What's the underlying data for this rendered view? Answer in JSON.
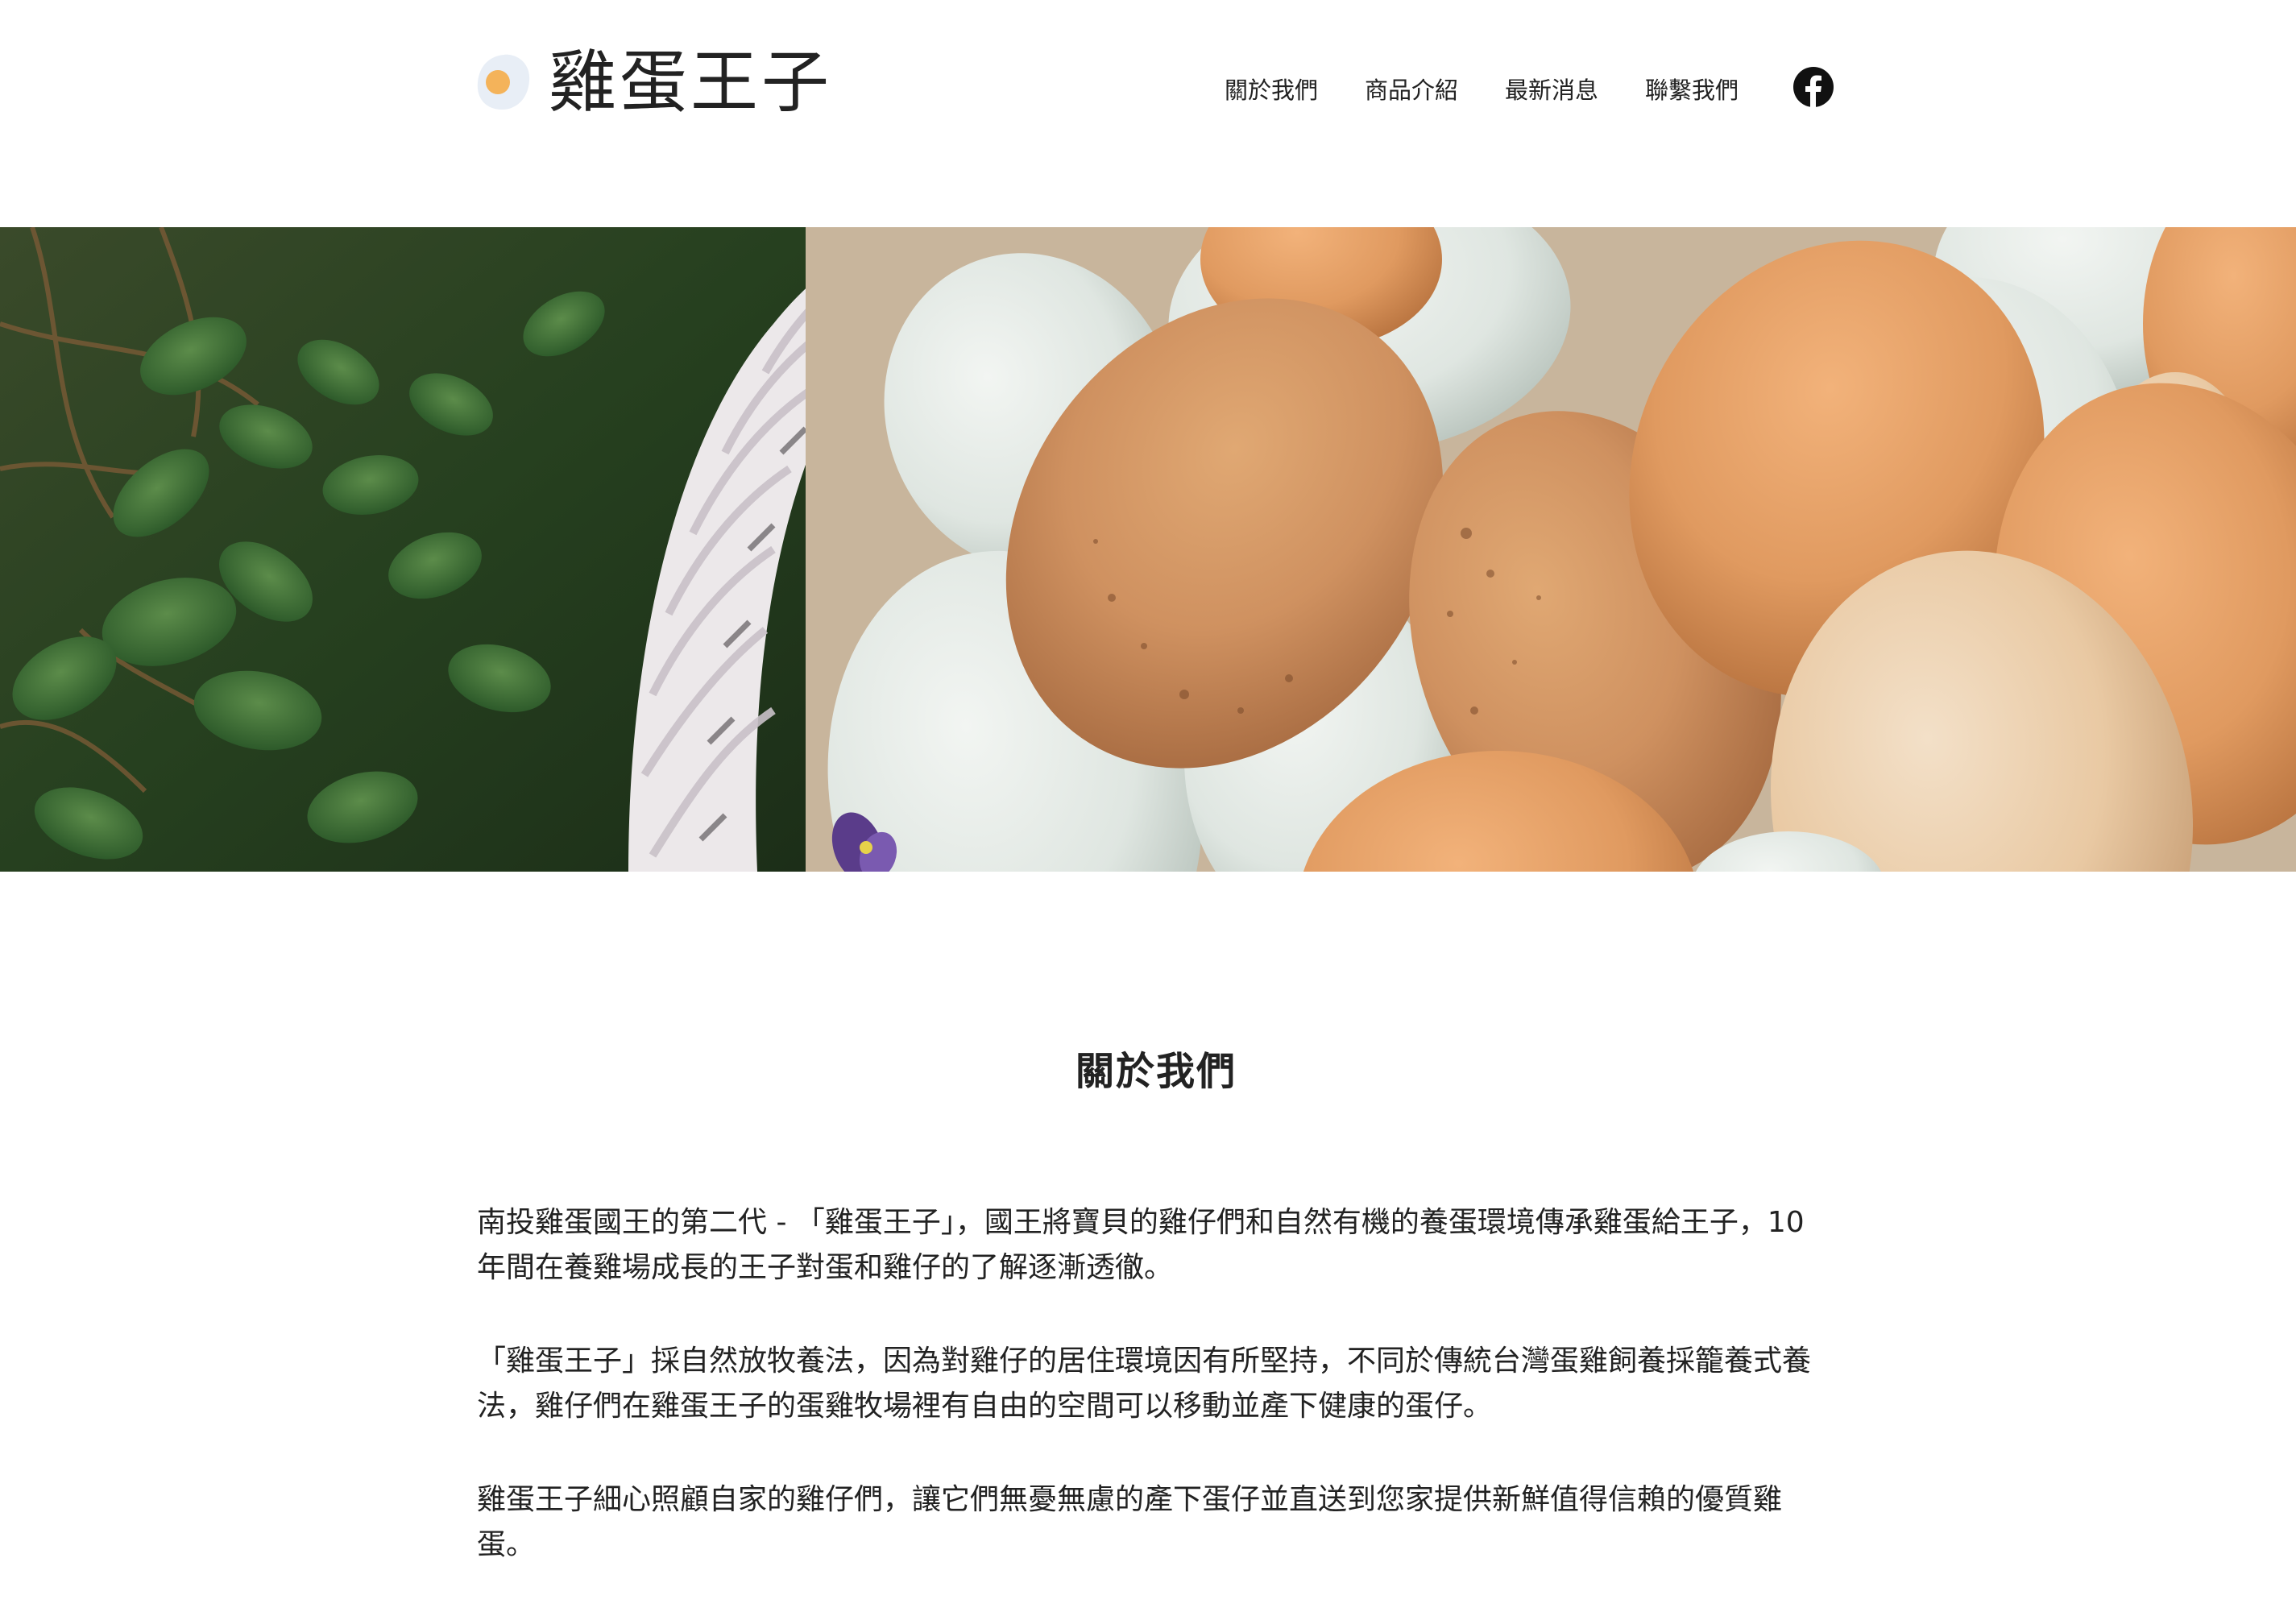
{
  "brand": {
    "name": "雞蛋王子",
    "logo_icon": "fried-egg-icon",
    "colors": {
      "yolk": "#f4b35a",
      "white": "#e8eef6"
    }
  },
  "nav": {
    "items": [
      {
        "label": "關於我們"
      },
      {
        "label": "商品介紹"
      },
      {
        "label": "最新消息"
      },
      {
        "label": "聯繫我們"
      }
    ],
    "social_icon": "facebook-icon"
  },
  "hero": {
    "image": "eggs-in-white-basket-photo"
  },
  "about": {
    "title": "關於我們",
    "paragraphs": [
      "南投雞蛋國王的第二代 - 「雞蛋王子」，國王將寶貝的雞仔們和自然有機的養蛋環境傳承雞蛋給王子，10年間在養雞場成長的王子對蛋和雞仔的了解逐漸透徹。",
      "「雞蛋王子」採自然放牧養法，因為對雞仔的居住環境因有所堅持，不同於傳統台灣蛋雞飼養採籠養式養法，雞仔們在雞蛋王子的蛋雞牧場裡有自由的空間可以移動並產下健康的蛋仔。",
      "雞蛋王子細心照顧自家的雞仔們，讓它們無憂無慮的產下蛋仔並直送到您家提供新鮮值得信賴的優質雞蛋。"
    ]
  }
}
